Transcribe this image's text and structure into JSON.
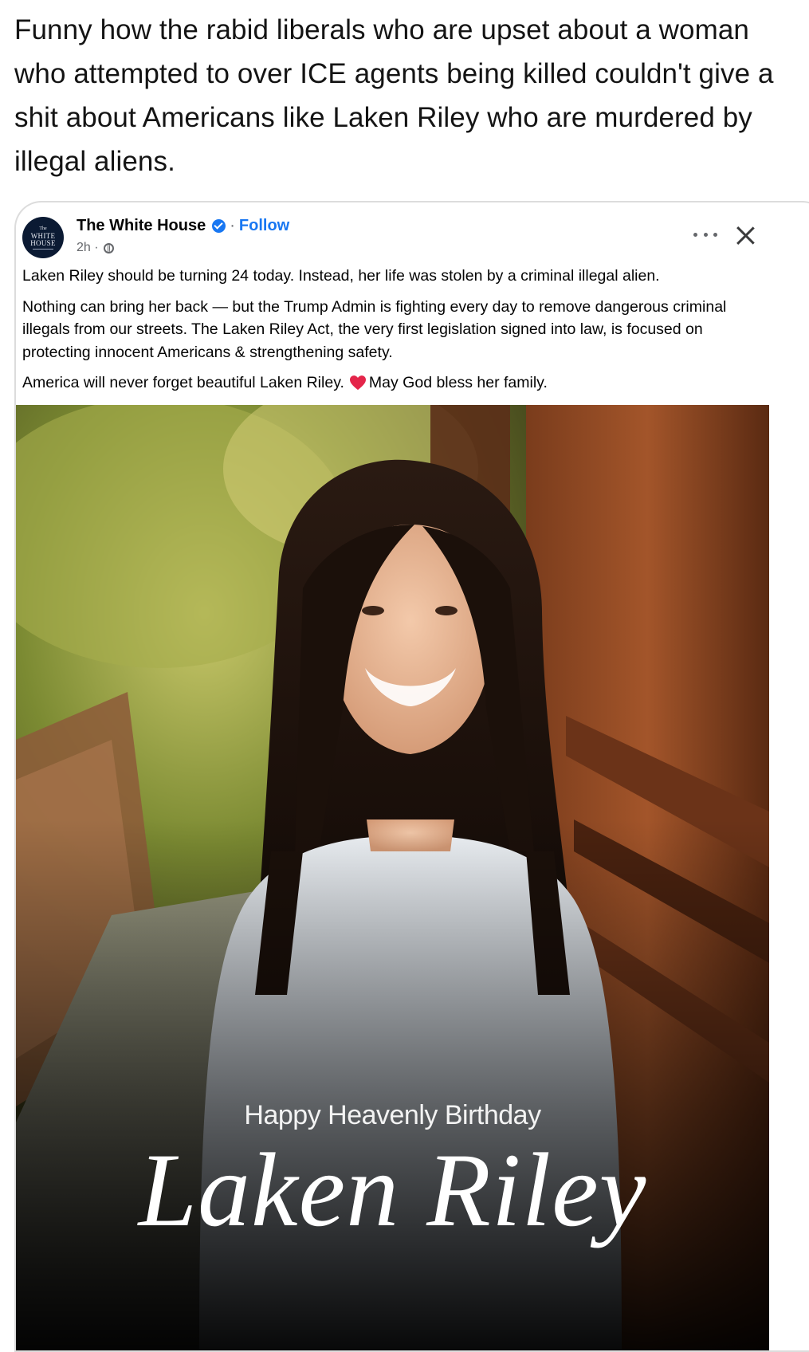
{
  "comment": {
    "text": "Funny how the rabid liberals who are upset about a woman who attempted to over ICE agents being killed couldn't give a shit about Americans like Laken Riley who are murdered by illegal aliens."
  },
  "shared_post": {
    "avatar": {
      "line1": "The",
      "line2": "WHITE",
      "line3": "HOUSE"
    },
    "page_name": "The White House",
    "separator": "·",
    "follow_label": "Follow",
    "timestamp": "2h ·",
    "audience_icon": "globe-icon",
    "body": {
      "para1": "Laken Riley should be turning 24 today. Instead, her life was stolen by a criminal illegal alien.",
      "para2": "Nothing can bring her back — but the Trump Admin is fighting every day to remove dangerous criminal illegals from our streets. The Laken Riley Act, the very first legislation signed into law, is focused on protecting innocent Americans & strengthening safety.",
      "para3_before": "America will never forget beautiful Laken Riley.",
      "para3_after": "May God bless her family."
    },
    "image": {
      "caption_small": "Happy Heavenly Birthday",
      "caption_large": "Laken Riley"
    }
  },
  "colors": {
    "link_blue": "#1877f2",
    "verified_blue": "#1877f2",
    "heart_red": "#e4254a",
    "meta_gray": "#65676b"
  }
}
